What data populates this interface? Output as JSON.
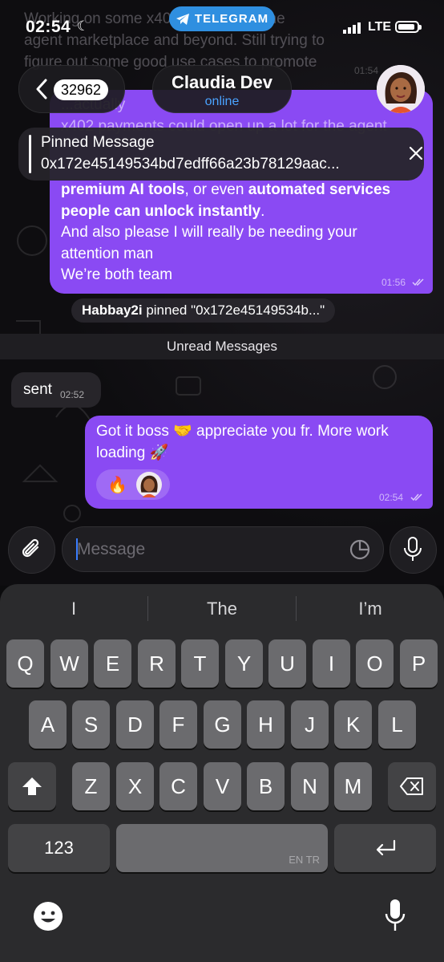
{
  "status_bar": {
    "time": "02:54",
    "app_pill": "TELEGRAM",
    "network": "LTE"
  },
  "header": {
    "back_count": "32962",
    "contact_name": "Claudia Dev",
    "contact_status": "online"
  },
  "background_message": {
    "lines": [
      "Working on some x402 stuff too for the",
      "agent marketplace and beyond.  Still trying to",
      "figure out some good use cases to promote"
    ],
    "time": "01:54"
  },
  "pinned": {
    "title": "Pinned Message",
    "text": "0x172e45149534bd7edff66a23b78129aac..."
  },
  "outgoing_message_1": {
    "partial_top": [
      "...actually",
      "x402 payments could open up a lot for the agent"
    ],
    "line_bold_a": "premium AI tools",
    "line_plain_a": ", or even ",
    "line_bold_b": "automated services",
    "line_bold_c": "people can unlock instantly",
    "line_end": ".",
    "lines_after": [
      "And also please I will really be needing your",
      "attention man",
      "We’re both team"
    ],
    "time": "01:56"
  },
  "service_message": {
    "actor": "Habbay2i",
    "text": " pinned \"0x172e45149534b...\""
  },
  "unread_label": "Unread Messages",
  "incoming_message": {
    "text": "sent",
    "time": "02:52"
  },
  "outgoing_message_2": {
    "line1": "Got it boss 🤝 appreciate you fr. More work",
    "line2": "loading 🚀",
    "reaction_emoji": "🔥",
    "time": "02:54"
  },
  "composer": {
    "placeholder": "Message"
  },
  "keyboard": {
    "suggestions": [
      "I",
      "The",
      "I’m"
    ],
    "row1": [
      "Q",
      "W",
      "E",
      "R",
      "T",
      "Y",
      "U",
      "I",
      "O",
      "P"
    ],
    "row2": [
      "A",
      "S",
      "D",
      "F",
      "G",
      "H",
      "J",
      "K",
      "L"
    ],
    "row3": [
      "Z",
      "X",
      "C",
      "V",
      "B",
      "N",
      "M"
    ],
    "numbers_key": "123",
    "space_lang": "EN TR"
  },
  "colors": {
    "accent": "#8a4af3",
    "link": "#4aa3ff",
    "telegram": "#2f8fe0"
  }
}
